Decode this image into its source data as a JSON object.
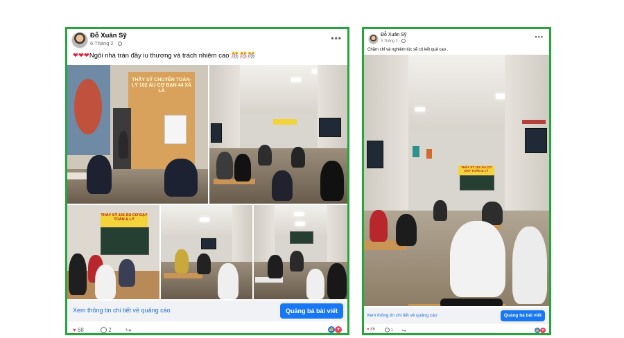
{
  "posts": [
    {
      "author": "Đỗ Xuân Sỹ",
      "date": "6 Tháng 2 ·",
      "more": "•••",
      "caption_hearts": "❤❤❤",
      "caption": "Ngôi nhà tràn đầy iu thương và trách nhiêm cao 🎊🎊🎊",
      "photo_texts": {
        "banner_1": "THẦY SỸ CHUYÊN TOÁN-LÝ 102 ÂU CƠ BẠN 44 XÃ LÀ",
        "banner_2": "THẦY SỸ 102 ÂU CƠ DẠY TOÁN & LÝ"
      },
      "cta_link": "Xem thông tin chi tiết về quảng cáo",
      "boost_label": "Quảng bá bài viết",
      "likes": "68",
      "comments": "2"
    },
    {
      "author": "Đỗ Xuân Sỹ",
      "date": "3 Tháng 2 ·",
      "more": "•••",
      "caption": "Chăm chỉ và nghiêm túc sẽ có kết quả cao .",
      "photo_texts": {
        "banner_1": "THẦY SỸ 102 ÂU CƠ DẠY TOÁN & LÝ"
      },
      "cta_link": "Xem thông tin chi tiết về quảng cáo",
      "boost_label": "Quảng bá bài viết",
      "likes": "86",
      "comments": "1"
    }
  ],
  "colors": {
    "frame": "#22a83a",
    "link": "#216fdb",
    "button": "#1877f2",
    "heart": "#f33e58"
  },
  "icons": [
    "globe-icon",
    "more-icon",
    "heart-icon",
    "comment-icon",
    "share-icon",
    "like-reaction-icon",
    "love-reaction-icon"
  ]
}
